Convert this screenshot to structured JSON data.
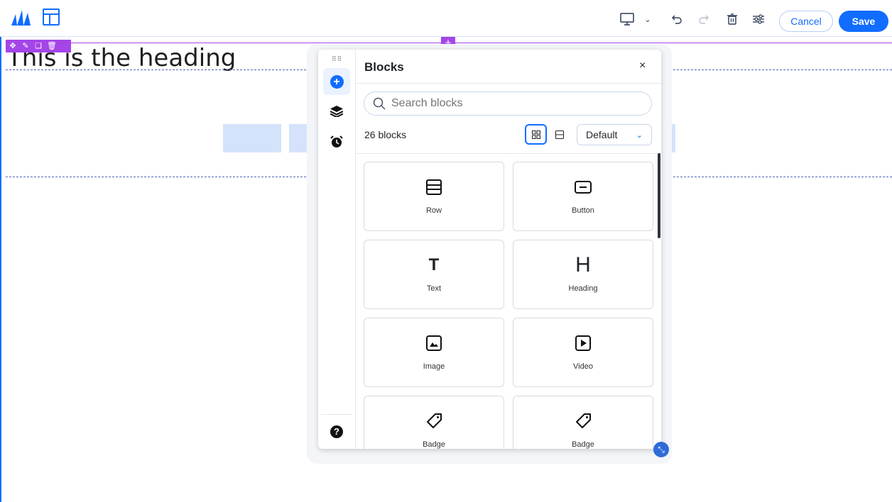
{
  "toolbar": {
    "cancel_label": "Cancel",
    "save_label": "Save",
    "device_icon": "desktop-icon",
    "icons": [
      "desktop-icon",
      "chevron-down-icon",
      "undo-icon",
      "redo-icon",
      "trash-icon",
      "settings-sliders-icon"
    ]
  },
  "canvas": {
    "heading_text": "This is the heading",
    "selection_color": "#a445e8"
  },
  "panel": {
    "title": "Blocks",
    "close_glyph": "×",
    "search_placeholder": "Search blocks",
    "count_text": "26 blocks",
    "sort_value": "Default",
    "blocks": [
      {
        "label": "Row",
        "icon": "row-icon"
      },
      {
        "label": "Button",
        "icon": "button-icon"
      },
      {
        "label": "Text",
        "icon": "text-icon"
      },
      {
        "label": "Heading",
        "icon": "heading-icon"
      },
      {
        "label": "Image",
        "icon": "image-icon"
      },
      {
        "label": "Video",
        "icon": "video-icon"
      },
      {
        "label": "Badge",
        "icon": "tag-icon"
      },
      {
        "label": "Badge",
        "icon": "tag-icon"
      }
    ]
  },
  "colors": {
    "accent": "#116dff"
  }
}
